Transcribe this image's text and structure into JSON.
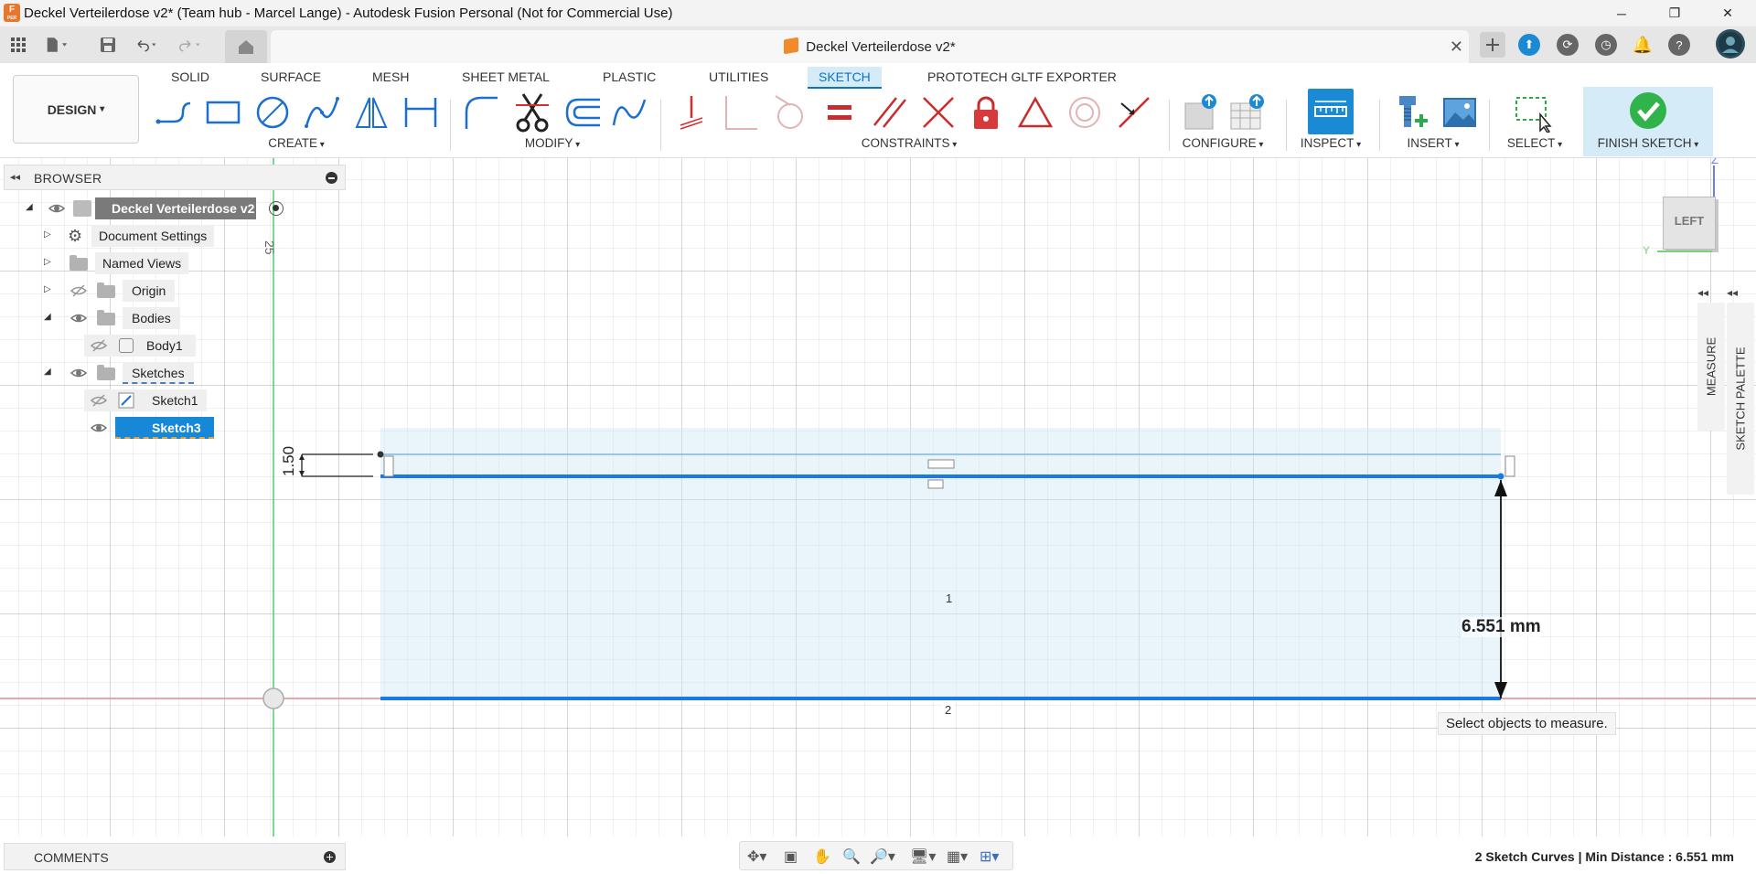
{
  "window": {
    "title": "Deckel Verteilerdose v2* (Team hub - Marcel Lange) - Autodesk Fusion Personal (Not for Commercial Use)",
    "logo_letter": "F",
    "logo_sub": "PER"
  },
  "tab": {
    "title": "Deckel Verteilerdose v2*"
  },
  "toolbar": {
    "design_label": "DESIGN",
    "workspace_tabs": [
      "SOLID",
      "SURFACE",
      "MESH",
      "SHEET METAL",
      "PLASTIC",
      "UTILITIES",
      "SKETCH",
      "PROTOTECH GLTF EXPORTER"
    ],
    "active_tab": "SKETCH",
    "groups": {
      "create": "CREATE",
      "modify": "MODIFY",
      "constraints": "CONSTRAINTS",
      "configure": "CONFIGURE",
      "inspect": "INSPECT",
      "insert": "INSERT",
      "select": "SELECT",
      "finish": "FINISH SKETCH"
    },
    "accent_color": "#0a74c4"
  },
  "browser": {
    "title": "BROWSER",
    "root": "Deckel Verteilerdose v2",
    "items": {
      "document_settings": "Document Settings",
      "named_views": "Named Views",
      "origin": "Origin",
      "bodies": "Bodies",
      "body1": "Body1",
      "sketches": "Sketches",
      "sketch1": "Sketch1",
      "sketch3": "Sketch3"
    }
  },
  "canvas": {
    "ruler_label": "25",
    "dim_label": "1.50",
    "measure_value": "6.551 mm",
    "curve_label_1": "1",
    "curve_label_2": "2",
    "measure_tip": "Select objects to measure."
  },
  "viewcube": {
    "face": "LEFT",
    "axis_z": "Z",
    "axis_y": "Y"
  },
  "side_panels": {
    "measure": "MEASURE",
    "sketch_palette": "SKETCH PALETTE"
  },
  "comments": {
    "label": "COMMENTS"
  },
  "status": {
    "text": "2 Sketch Curves | Min Distance : 6.551 mm"
  }
}
